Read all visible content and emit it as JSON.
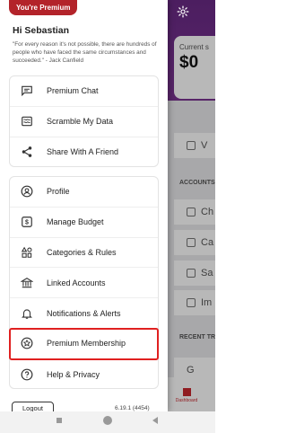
{
  "background": {
    "card_label": "Current s",
    "card_amount": "$0",
    "row_view": "V",
    "accounts_header": "ACCOUNTS",
    "accounts": [
      "Ch",
      "Ca",
      "Sa",
      "Im"
    ],
    "recent_header": "RECENT TR",
    "recent_letter": "G",
    "dashboard_label": "Dashboard"
  },
  "drawer": {
    "badge": "You're Premium",
    "greeting": "Hi Sebastian",
    "quote": "\"For every reason it's not possible, there are hundreds of people who have faced the same circumstances and succeeded.\" - Jack Canfield",
    "group1": [
      {
        "label": "Premium Chat",
        "icon": "chat-icon"
      },
      {
        "label": "Scramble My Data",
        "icon": "scramble-icon"
      },
      {
        "label": "Share With A Friend",
        "icon": "share-icon"
      }
    ],
    "group2": [
      {
        "label": "Profile",
        "icon": "profile-icon"
      },
      {
        "label": "Manage Budget",
        "icon": "dollar-icon"
      },
      {
        "label": "Categories & Rules",
        "icon": "categories-icon"
      },
      {
        "label": "Linked Accounts",
        "icon": "bank-icon"
      },
      {
        "label": "Notifications & Alerts",
        "icon": "bell-icon"
      },
      {
        "label": "Premium Membership",
        "icon": "star-badge-icon"
      },
      {
        "label": "Help & Privacy",
        "icon": "help-icon"
      }
    ],
    "logout": "Logout",
    "version": "6.19.1 (4454)"
  },
  "colors": {
    "accent": "#b3232a",
    "highlight": "#e02020",
    "header_purple": "#6a2a86"
  }
}
